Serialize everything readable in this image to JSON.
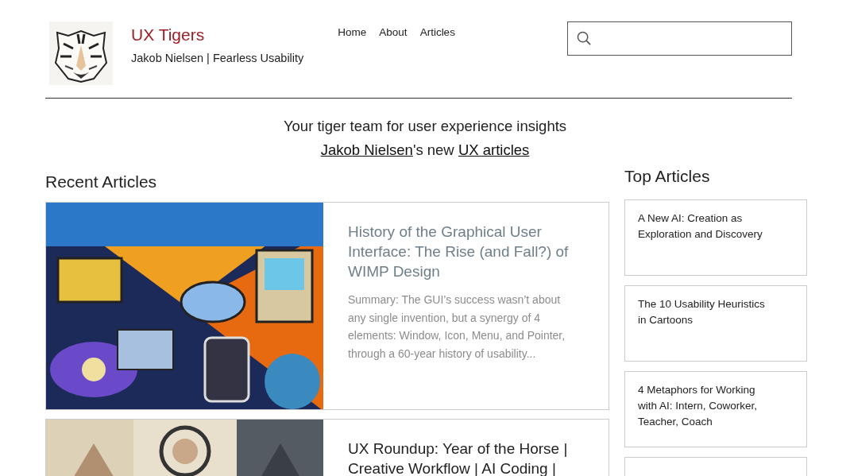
{
  "header": {
    "site_title": "UX Tigers",
    "tagline": "Jakob Nielsen | Fearless Usability",
    "nav": [
      {
        "label": "Home"
      },
      {
        "label": "About"
      },
      {
        "label": "Articles"
      }
    ],
    "search": {
      "kind": "search"
    }
  },
  "intro": {
    "text": "Your tiger team for user experience insights",
    "line": [
      {
        "text": "Jakob Nielsen",
        "link": true
      },
      {
        "text": "'s new ",
        "link": false
      },
      {
        "text": "UX articles",
        "link": true
      }
    ]
  },
  "recent": {
    "heading": "Recent Articles",
    "articles": [
      {
        "title": "History of the Graphical User Interface: The Rise (and Fall?) of WIMP Design",
        "summary": "Summary:  The GUI’s success wasn’t about any single invention, but a synergy of 4 elements: Window, Icon, Menu, and Pointer, through a 60-year history of usability..."
      },
      {
        "title": "UX Roundup: Year of the Horse | Creative Workflow | AI Coding |"
      }
    ]
  },
  "top": {
    "heading": "Top Articles",
    "articles": [
      {
        "title": "A New AI: Creation as Exploration and Discovery"
      },
      {
        "title": "The 10 Usability Heuristics in Cartoons"
      },
      {
        "title": "4 Metaphors for Working with AI: Intern, Coworker, Teacher, Coach"
      }
    ]
  }
}
